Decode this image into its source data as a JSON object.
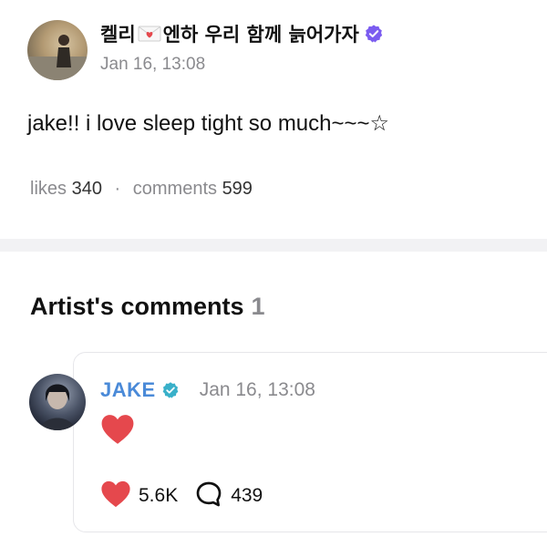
{
  "post": {
    "author_name_part1": "켈리",
    "author_name_part2": "엔하 우리 함께 늙어가자",
    "timestamp": "Jan 16, 13:08",
    "body": "jake!! i love sleep tight so much~~~☆",
    "likes_label": "likes",
    "likes_count": "340",
    "comments_label": "comments",
    "comments_count": "599"
  },
  "artist_comments": {
    "title": "Artist's comments",
    "count": "1",
    "comment": {
      "author": "JAKE",
      "timestamp": "Jan 16, 13:08",
      "like_count": "5.6K",
      "reply_count": "439"
    }
  },
  "colors": {
    "artist_name": "#4a8ad8",
    "verified_post": "#7b5cf0",
    "verified_artist": "#39b0c9",
    "heart": "#e5484d",
    "muted_text": "#8a8a8e",
    "divider": "#f2f2f4"
  },
  "icons": {
    "post_verified": "verified-badge-icon",
    "artist_verified": "verified-badge-icon",
    "envelope": "love-letter-icon",
    "heart": "heart-icon",
    "reply": "speech-bubble-icon"
  }
}
